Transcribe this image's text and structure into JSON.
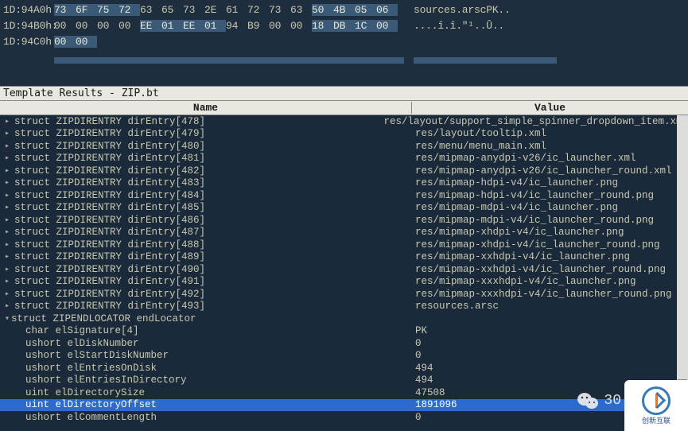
{
  "hex": {
    "rows": [
      {
        "addr": "1D:94A0h:",
        "bytes": [
          "73",
          "6F",
          "75",
          "72",
          "63",
          "65",
          "73",
          "2E",
          "61",
          "72",
          "73",
          "63",
          "50",
          "4B",
          "05",
          "06"
        ],
        "hl": [
          1,
          1,
          1,
          1,
          0,
          0,
          0,
          0,
          0,
          0,
          0,
          0,
          1,
          1,
          1,
          1
        ],
        "text": "sources.arscPK.."
      },
      {
        "addr": "1D:94B0h:",
        "bytes": [
          "00",
          "00",
          "00",
          "00",
          "EE",
          "01",
          "EE",
          "01",
          "94",
          "B9",
          "00",
          "00",
          "18",
          "DB",
          "1C",
          "00"
        ],
        "hl": [
          0,
          0,
          0,
          0,
          1,
          1,
          1,
          1,
          0,
          0,
          0,
          0,
          1,
          1,
          1,
          1
        ],
        "text": "....î.î.\"¹..Û.."
      },
      {
        "addr": "1D:94C0h:",
        "bytes": [
          "00",
          "00"
        ],
        "hl": [
          1,
          1
        ],
        "text": ""
      }
    ]
  },
  "template": {
    "title": "Template Results - ZIP.bt",
    "columns": {
      "name": "Name",
      "value": "Value"
    },
    "rows": [
      {
        "exp": "+",
        "ind": 1,
        "name": "struct ZIPDIRENTRY dirEntry[478]",
        "value": "res/layout/support_simple_spinner_dropdown_item.xml"
      },
      {
        "exp": "+",
        "ind": 1,
        "name": "struct ZIPDIRENTRY dirEntry[479]",
        "value": "res/layout/tooltip.xml"
      },
      {
        "exp": "+",
        "ind": 1,
        "name": "struct ZIPDIRENTRY dirEntry[480]",
        "value": "res/menu/menu_main.xml"
      },
      {
        "exp": "+",
        "ind": 1,
        "name": "struct ZIPDIRENTRY dirEntry[481]",
        "value": "res/mipmap-anydpi-v26/ic_launcher.xml"
      },
      {
        "exp": "+",
        "ind": 1,
        "name": "struct ZIPDIRENTRY dirEntry[482]",
        "value": "res/mipmap-anydpi-v26/ic_launcher_round.xml"
      },
      {
        "exp": "+",
        "ind": 1,
        "name": "struct ZIPDIRENTRY dirEntry[483]",
        "value": "res/mipmap-hdpi-v4/ic_launcher.png"
      },
      {
        "exp": "+",
        "ind": 1,
        "name": "struct ZIPDIRENTRY dirEntry[484]",
        "value": "res/mipmap-hdpi-v4/ic_launcher_round.png"
      },
      {
        "exp": "+",
        "ind": 1,
        "name": "struct ZIPDIRENTRY dirEntry[485]",
        "value": "res/mipmap-mdpi-v4/ic_launcher.png"
      },
      {
        "exp": "+",
        "ind": 1,
        "name": "struct ZIPDIRENTRY dirEntry[486]",
        "value": "res/mipmap-mdpi-v4/ic_launcher_round.png"
      },
      {
        "exp": "+",
        "ind": 1,
        "name": "struct ZIPDIRENTRY dirEntry[487]",
        "value": "res/mipmap-xhdpi-v4/ic_launcher.png"
      },
      {
        "exp": "+",
        "ind": 1,
        "name": "struct ZIPDIRENTRY dirEntry[488]",
        "value": "res/mipmap-xhdpi-v4/ic_launcher_round.png"
      },
      {
        "exp": "+",
        "ind": 1,
        "name": "struct ZIPDIRENTRY dirEntry[489]",
        "value": "res/mipmap-xxhdpi-v4/ic_launcher.png"
      },
      {
        "exp": "+",
        "ind": 1,
        "name": "struct ZIPDIRENTRY dirEntry[490]",
        "value": "res/mipmap-xxhdpi-v4/ic_launcher_round.png"
      },
      {
        "exp": "+",
        "ind": 1,
        "name": "struct ZIPDIRENTRY dirEntry[491]",
        "value": "res/mipmap-xxxhdpi-v4/ic_launcher.png"
      },
      {
        "exp": "+",
        "ind": 1,
        "name": "struct ZIPDIRENTRY dirEntry[492]",
        "value": "res/mipmap-xxxhdpi-v4/ic_launcher_round.png"
      },
      {
        "exp": "+",
        "ind": 1,
        "name": "struct ZIPDIRENTRY dirEntry[493]",
        "value": "resources.arsc"
      },
      {
        "exp": "-",
        "ind": 0,
        "name": "struct ZIPENDLOCATOR endLocator",
        "value": ""
      },
      {
        "exp": "",
        "ind": 2,
        "name": "char elSignature[4]",
        "value": "PK"
      },
      {
        "exp": "",
        "ind": 2,
        "name": "ushort elDiskNumber",
        "value": "0"
      },
      {
        "exp": "",
        "ind": 2,
        "name": "ushort elStartDiskNumber",
        "value": "0"
      },
      {
        "exp": "",
        "ind": 2,
        "name": "ushort elEntriesOnDisk",
        "value": "494"
      },
      {
        "exp": "",
        "ind": 2,
        "name": "ushort elEntriesInDirectory",
        "value": "494"
      },
      {
        "exp": "",
        "ind": 2,
        "name": "uint elDirectorySize",
        "value": "47508"
      },
      {
        "exp": "",
        "ind": 2,
        "name": "uint elDirectoryOffset",
        "value": "1891096",
        "sel": true
      },
      {
        "exp": "",
        "ind": 2,
        "name": "ushort elCommentLength",
        "value": "0"
      }
    ]
  },
  "watermark": {
    "wechat_count": "30",
    "brand": "创新互联"
  }
}
